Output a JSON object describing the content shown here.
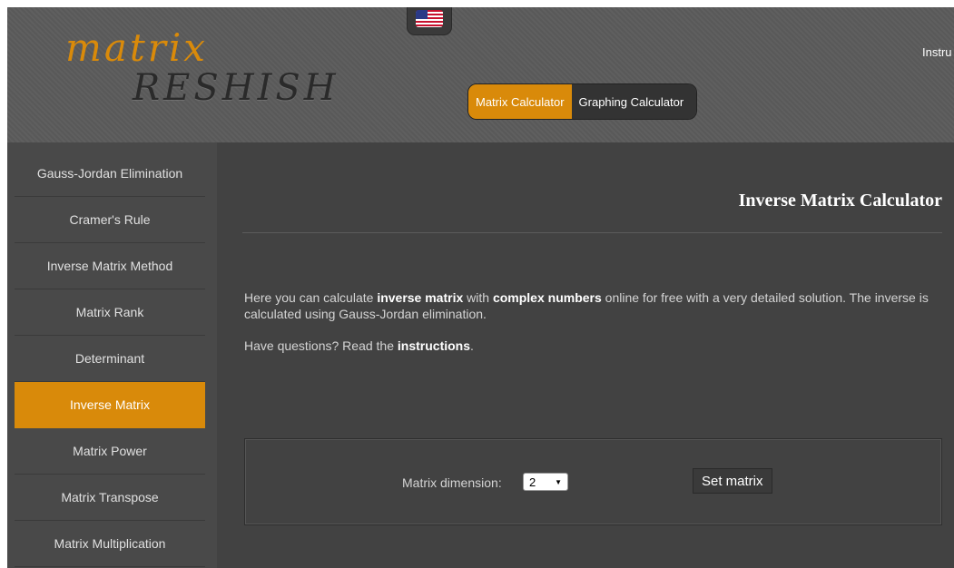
{
  "header": {
    "logo_top": "matrix",
    "logo_bottom": "RESHISH",
    "flag_icon": "us-flag-icon",
    "instructions_link": "Instru",
    "calculator_switch": {
      "active": "Matrix Calculator",
      "inactive": "Graphing Calculator"
    }
  },
  "sidebar": {
    "items": [
      {
        "label": "Gauss-Jordan Elimination"
      },
      {
        "label": "Cramer's Rule"
      },
      {
        "label": "Inverse Matrix Method"
      },
      {
        "label": "Matrix Rank"
      },
      {
        "label": "Determinant"
      },
      {
        "label": "Inverse Matrix",
        "active": true
      },
      {
        "label": "Matrix Power"
      },
      {
        "label": "Matrix Transpose"
      },
      {
        "label": "Matrix Multiplication"
      }
    ]
  },
  "main": {
    "title": "Inverse Matrix Calculator",
    "intro": {
      "part1": "Here you can calculate ",
      "bold1": "inverse matrix",
      "part2": " with ",
      "bold2": "complex numbers",
      "part3": " online for free with a very detailed solution. The inverse is calculated using Gauss-Jordan elimination."
    },
    "questions": {
      "prefix": "Have questions? Read the ",
      "link": "instructions",
      "suffix": "."
    },
    "dimension": {
      "label": "Matrix dimension:",
      "value": "2",
      "button": "Set matrix"
    }
  },
  "colors": {
    "accent": "#d98a0a",
    "header_bg": "#5b5b5b",
    "sidebar_bg": "#494949",
    "main_bg": "#424242"
  }
}
